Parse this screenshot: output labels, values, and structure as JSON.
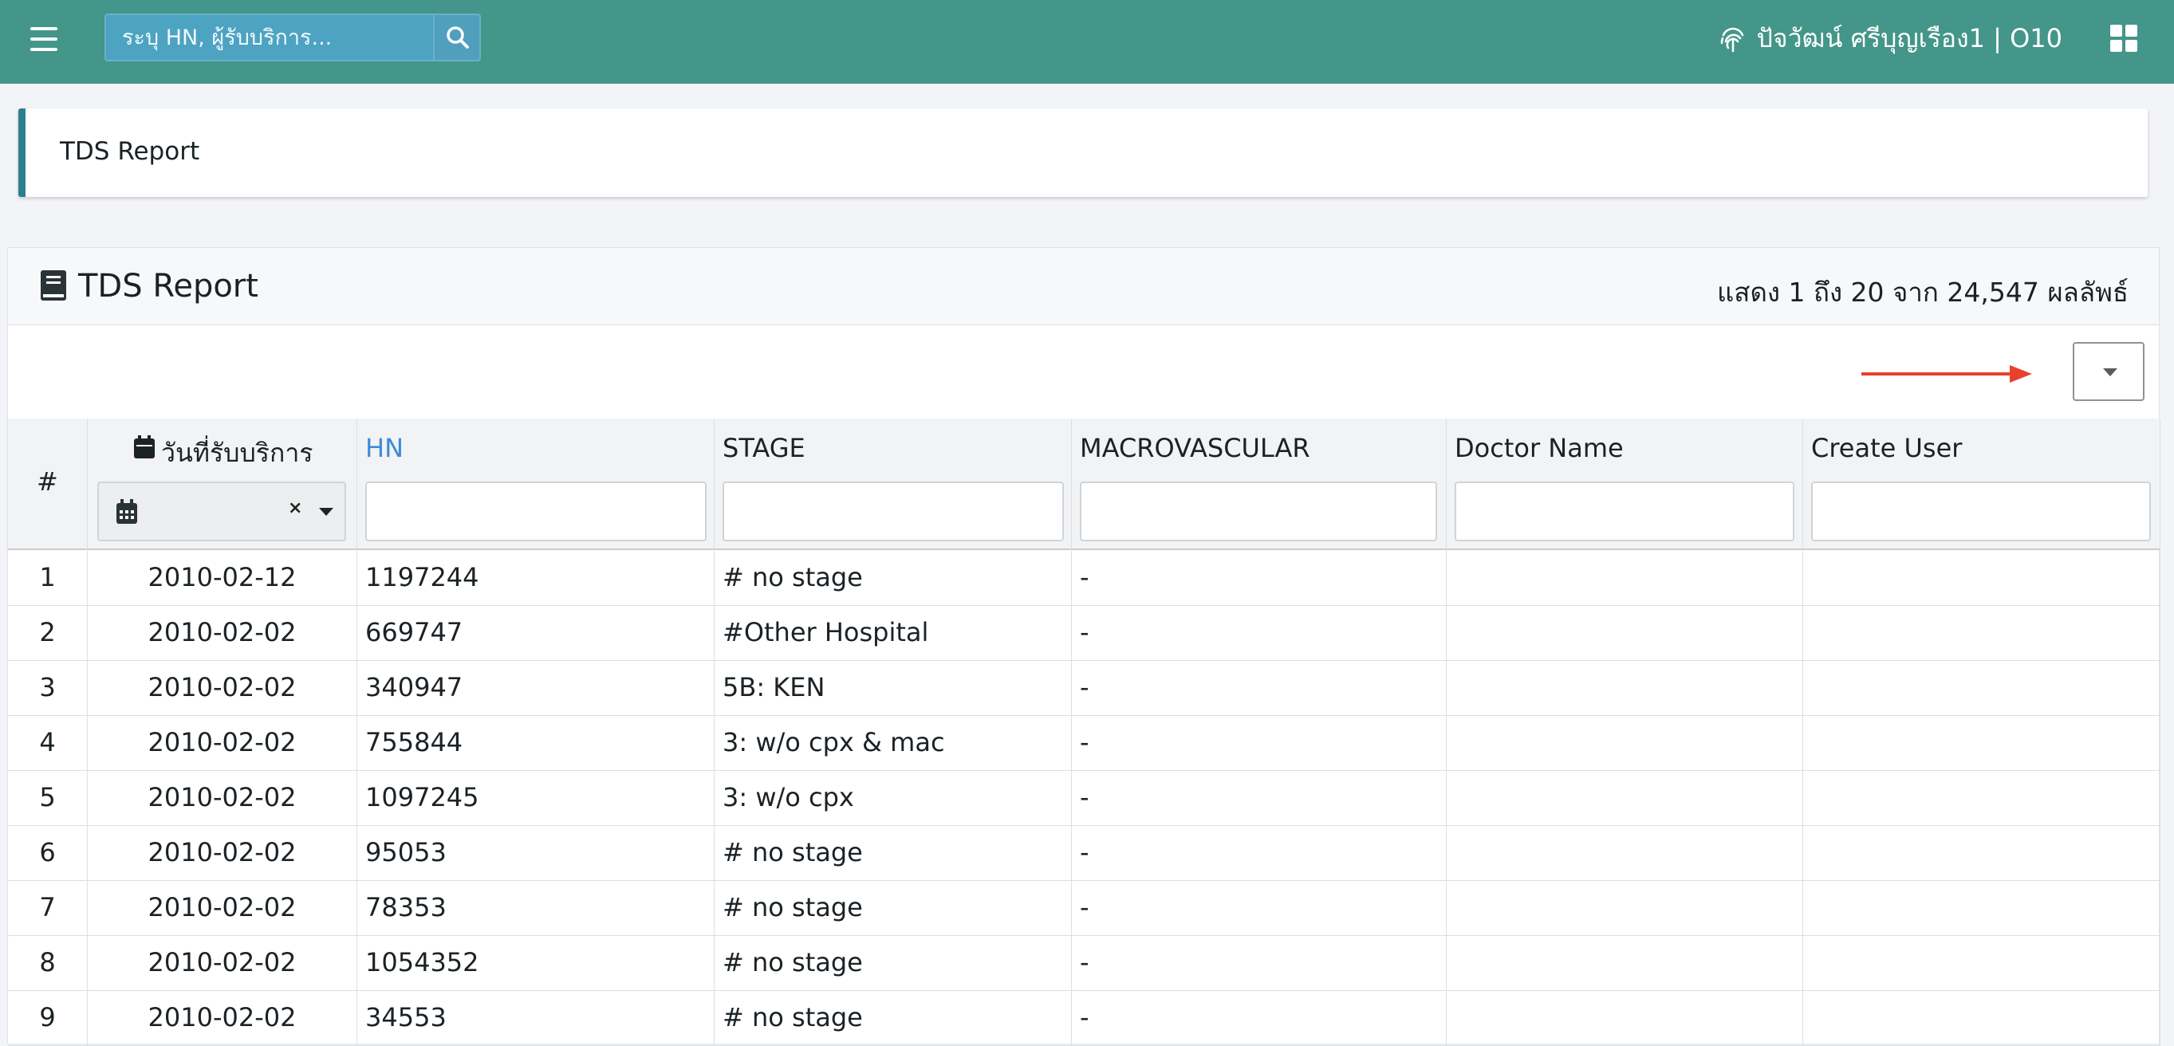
{
  "navbar": {
    "search_placeholder": "ระบุ HN, ผู้รับบริการ...",
    "user_label": "ปัจวัฒน์ ศรีบุญเรือง1 | O10",
    "color": "#439689"
  },
  "page": {
    "breadcrumb_title": "TDS Report"
  },
  "panel": {
    "title": "TDS Report",
    "result_summary": "แสดง 1 ถึง 20 จาก 24,547 ผลลัพธ์"
  },
  "table": {
    "columns": [
      {
        "key": "index",
        "label": "#"
      },
      {
        "key": "service_date",
        "label": "วันที่รับบริการ"
      },
      {
        "key": "hn",
        "label": "HN"
      },
      {
        "key": "stage",
        "label": "STAGE"
      },
      {
        "key": "macrovascular",
        "label": "MACROVASCULAR"
      },
      {
        "key": "doctor_name",
        "label": "Doctor Name"
      },
      {
        "key": "create_user",
        "label": "Create User"
      }
    ],
    "rows": [
      {
        "index": "1",
        "service_date": "2010-02-12",
        "hn": "1197244",
        "stage": "# no stage",
        "macrovascular": "-",
        "doctor_name": "",
        "create_user": ""
      },
      {
        "index": "2",
        "service_date": "2010-02-02",
        "hn": "669747",
        "stage": "#Other Hospital",
        "macrovascular": "-",
        "doctor_name": "",
        "create_user": ""
      },
      {
        "index": "3",
        "service_date": "2010-02-02",
        "hn": "340947",
        "stage": "5B: KEN",
        "macrovascular": "-",
        "doctor_name": "",
        "create_user": ""
      },
      {
        "index": "4",
        "service_date": "2010-02-02",
        "hn": "755844",
        "stage": "3: w/o cpx & mac",
        "macrovascular": "-",
        "doctor_name": "",
        "create_user": ""
      },
      {
        "index": "5",
        "service_date": "2010-02-02",
        "hn": "1097245",
        "stage": "3: w/o cpx",
        "macrovascular": "-",
        "doctor_name": "",
        "create_user": ""
      },
      {
        "index": "6",
        "service_date": "2010-02-02",
        "hn": "95053",
        "stage": "# no stage",
        "macrovascular": "-",
        "doctor_name": "",
        "create_user": ""
      },
      {
        "index": "7",
        "service_date": "2010-02-02",
        "hn": "78353",
        "stage": "# no stage",
        "macrovascular": "-",
        "doctor_name": "",
        "create_user": ""
      },
      {
        "index": "8",
        "service_date": "2010-02-02",
        "hn": "1054352",
        "stage": "# no stage",
        "macrovascular": "-",
        "doctor_name": "",
        "create_user": ""
      },
      {
        "index": "9",
        "service_date": "2010-02-02",
        "hn": "34553",
        "stage": "# no stage",
        "macrovascular": "-",
        "doctor_name": "",
        "create_user": ""
      }
    ]
  },
  "icons": {
    "menu": "hamburger-menu-icon",
    "search": "search-icon",
    "fingerprint": "fingerprint-icon",
    "apps": "apps-grid-icon",
    "book": "book-icon",
    "calendar": "calendar-icon",
    "arrow": "red-arrow-icon",
    "arrow_color": "#e8412c",
    "link_color": "#3e8bd8"
  }
}
